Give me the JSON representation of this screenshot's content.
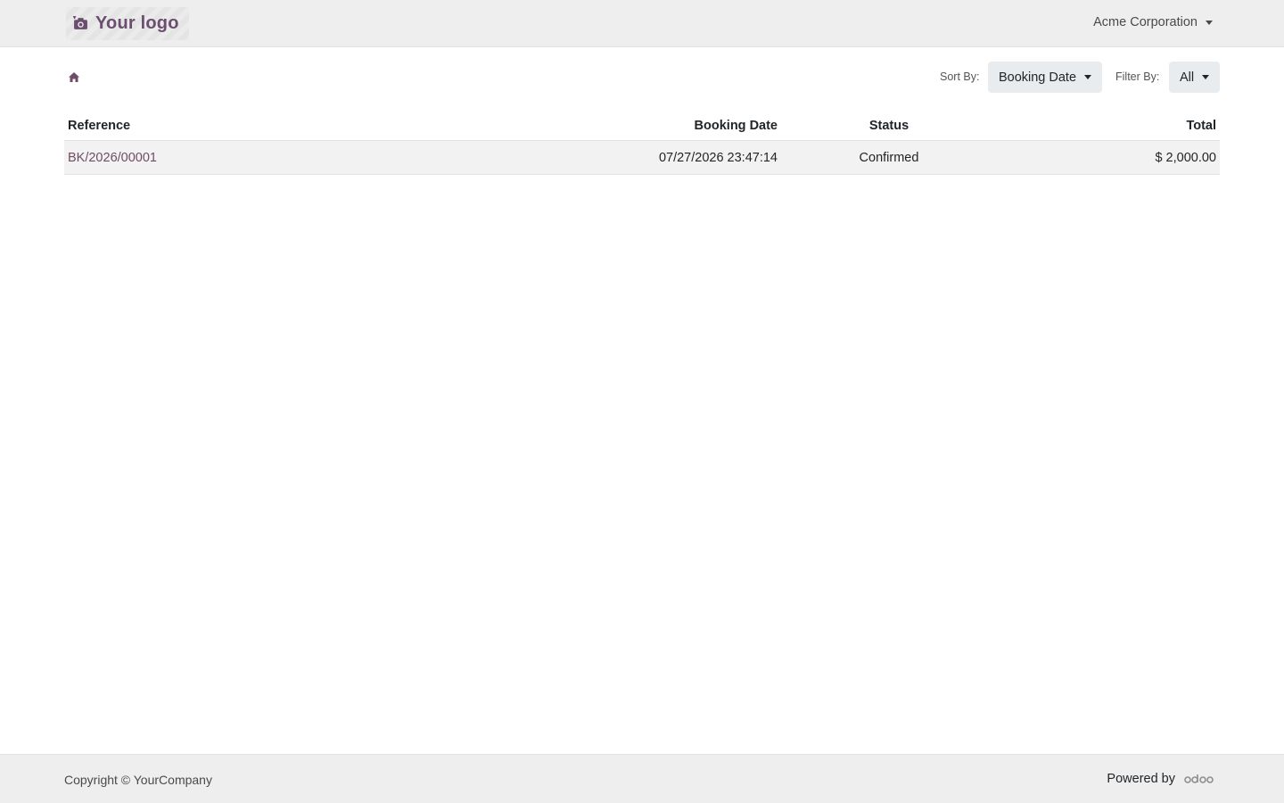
{
  "header": {
    "logo_text": "Your logo",
    "logo_icon": "camera-icon",
    "company": "Acme Corporation"
  },
  "toolbar": {
    "home_icon": "home-icon",
    "sort_label": "Sort By:",
    "sort_value": "Booking Date",
    "filter_label": "Filter By:",
    "filter_value": "All"
  },
  "table": {
    "columns": [
      "Reference",
      "Booking Date",
      "Status",
      "Total"
    ],
    "rows": [
      {
        "reference": "BK/2026/00001",
        "booking_date": "07/27/2026 23:47:14",
        "status": "Confirmed",
        "total": "$ 2,000.00"
      }
    ]
  },
  "footer": {
    "copyright": "Copyright © YourCompany",
    "powered_by": "Powered by",
    "brand_icon": "odoo-logo-icon"
  },
  "colors": {
    "accent": "#714b67",
    "bar_bg": "#eeeeee",
    "row_bg": "#f2f2f2"
  }
}
